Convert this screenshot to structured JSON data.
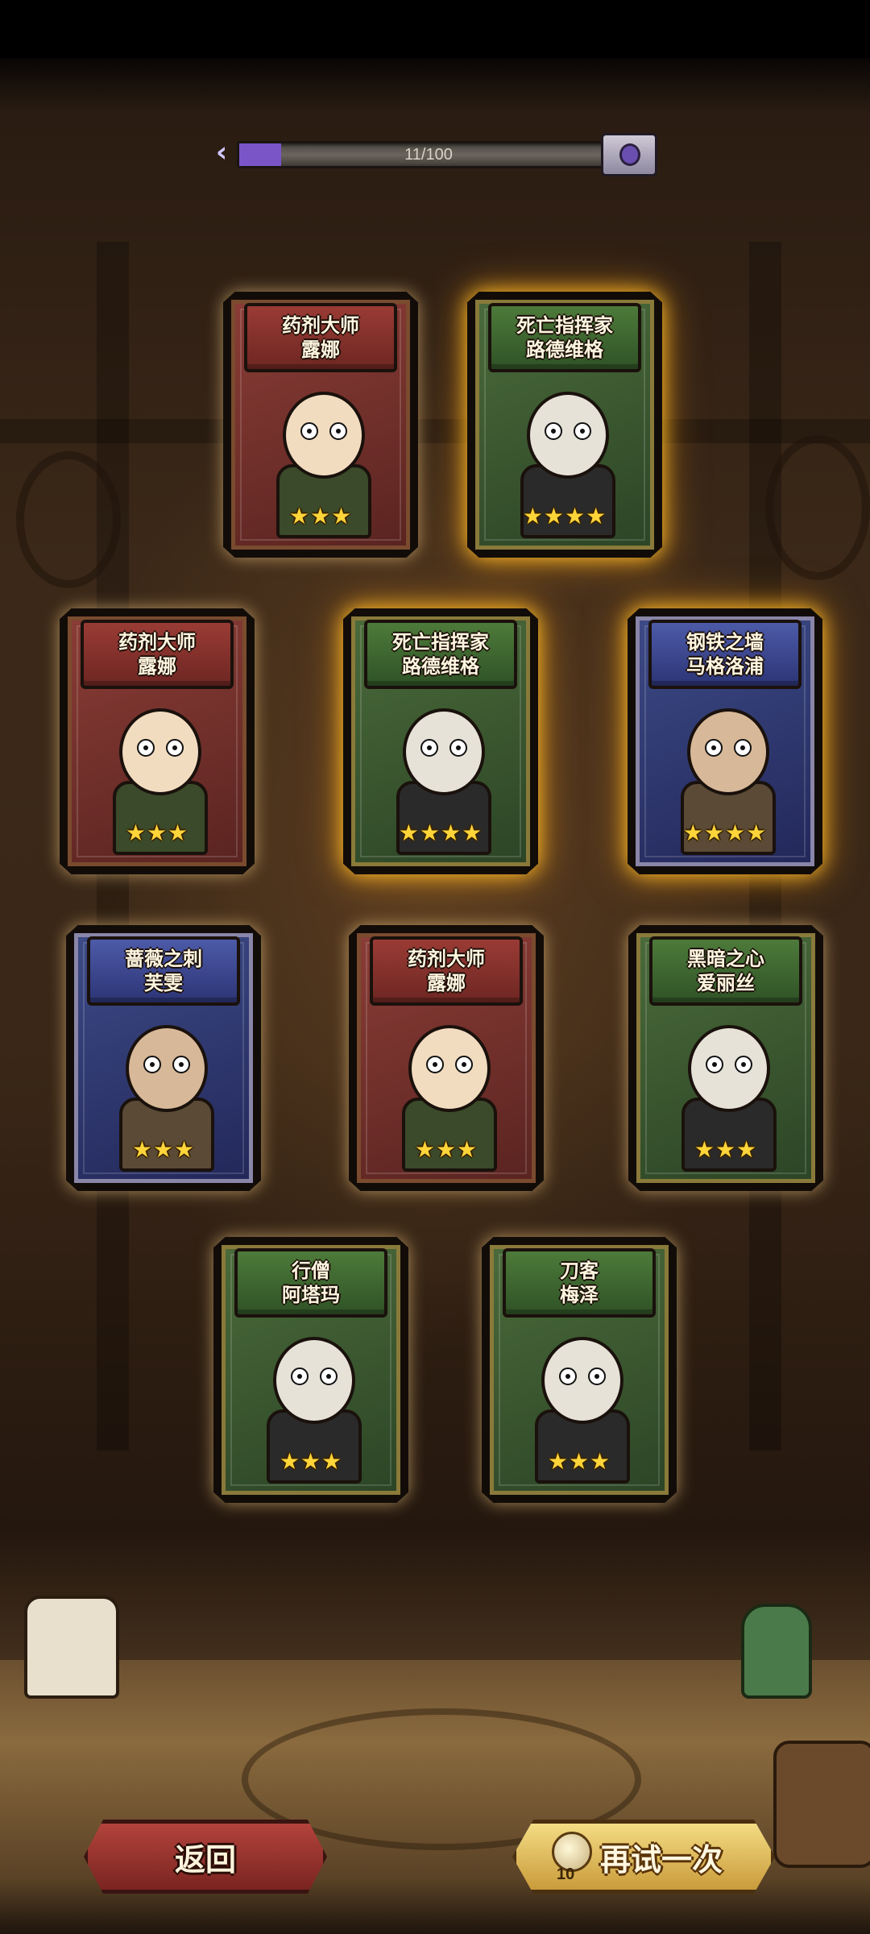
{
  "progress": {
    "text": "11/100",
    "value": 11,
    "max": 100,
    "fill_color": "#7a55c8"
  },
  "cards": [
    {
      "title_line1": "药剂大师",
      "title_line2": "露娜",
      "stars": "★★★",
      "star_count": 3,
      "theme": "red",
      "glow": "soft"
    },
    {
      "title_line1": "死亡指挥家",
      "title_line2": "路德维格",
      "stars": "★★★★",
      "star_count": 4,
      "theme": "green",
      "glow": "gold"
    },
    {
      "title_line1": "药剂大师",
      "title_line2": "露娜",
      "stars": "★★★",
      "star_count": 3,
      "theme": "red",
      "glow": "soft"
    },
    {
      "title_line1": "死亡指挥家",
      "title_line2": "路德维格",
      "stars": "★★★★",
      "star_count": 4,
      "theme": "green",
      "glow": "gold"
    },
    {
      "title_line1": "钢铁之墙",
      "title_line2": "马格洛浦",
      "stars": "★★★★",
      "star_count": 4,
      "theme": "blue",
      "glow": "gold"
    },
    {
      "title_line1": "蔷薇之刺",
      "title_line2": "芙雯",
      "stars": "★★★",
      "star_count": 3,
      "theme": "blue",
      "glow": "soft"
    },
    {
      "title_line1": "药剂大师",
      "title_line2": "露娜",
      "stars": "★★★",
      "star_count": 3,
      "theme": "red",
      "glow": "soft"
    },
    {
      "title_line1": "黑暗之心",
      "title_line2": "爱丽丝",
      "stars": "★★★",
      "star_count": 3,
      "theme": "green",
      "glow": "soft"
    },
    {
      "title_line1": "行僧",
      "title_line2": "阿塔玛",
      "stars": "★★★",
      "star_count": 3,
      "theme": "green",
      "glow": "soft"
    },
    {
      "title_line1": "刀客",
      "title_line2": "梅泽",
      "stars": "★★★",
      "star_count": 3,
      "theme": "green",
      "glow": "soft"
    }
  ],
  "buttons": {
    "back": "返回",
    "retry": "再试一次",
    "retry_cost": "10",
    "retry_cost_icon": "scroll-icon"
  },
  "colors": {
    "gold_glow": "#ffbe28",
    "back_button": "#b3433c",
    "retry_button": "#f4dc84"
  }
}
